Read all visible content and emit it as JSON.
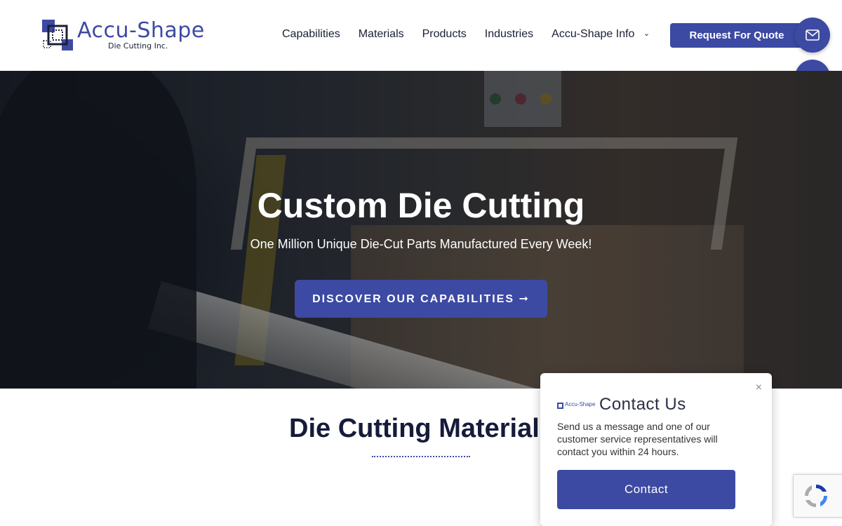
{
  "brand": {
    "name": "Accu-Shape",
    "tagline": "Die Cutting Inc.",
    "accent_color": "#3d4aa3"
  },
  "nav": {
    "items": [
      "Capabilities",
      "Materials",
      "Products",
      "Industries",
      "Accu-Shape Info"
    ],
    "quote_button": "Request For Quote"
  },
  "floating_buttons": {
    "mail_icon": "envelope-icon",
    "phone_icon": "phone-icon"
  },
  "hero": {
    "title": "Custom Die Cutting",
    "subtitle": "One Million Unique Die-Cut Parts Manufactured Every Week!",
    "cta": "DISCOVER OUR CAPABILITIES ➞"
  },
  "section": {
    "title": "Die Cutting Materials"
  },
  "popup": {
    "close": "×",
    "logo_text": "Accu-Shape",
    "title": "Contact Us",
    "text": "Send us a message and one of our customer service representatives will contact you within 24 hours.",
    "button": "Contact"
  },
  "recaptcha": {
    "icon": "recaptcha-icon"
  }
}
